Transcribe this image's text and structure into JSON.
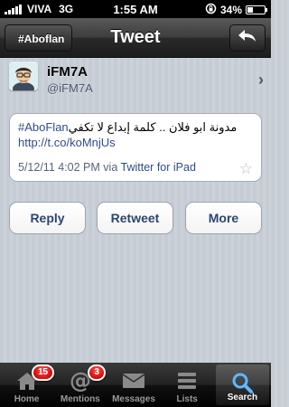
{
  "status_bar": {
    "carrier": "VIVA",
    "network": "3G",
    "time": "1:55 AM",
    "battery": "34%",
    "battery_level": 0.34
  },
  "nav": {
    "back_label": "#Aboflan",
    "title": "Tweet",
    "share_icon": "reply-arrow-icon"
  },
  "profile": {
    "name": "iFM7A",
    "handle": "@iFM7A"
  },
  "tweet": {
    "hashtag": "#AboFlan",
    "text": "مدونة ابو فلان .. كلمة إبداع لا تكفي",
    "link": "http://t.co/koMnjUs",
    "timestamp": "5/12/11 4:02 PM",
    "via": "via",
    "source": "Twitter for iPad"
  },
  "actions": {
    "reply": "Reply",
    "retweet": "Retweet",
    "more": "More"
  },
  "tabs": [
    {
      "label": "Home",
      "icon": "home-icon",
      "badge": "15"
    },
    {
      "label": "Mentions",
      "icon": "at-icon",
      "badge": "3"
    },
    {
      "label": "Messages",
      "icon": "envelope-icon",
      "badge": ""
    },
    {
      "label": "Lists",
      "icon": "list-icon",
      "badge": ""
    },
    {
      "label": "Search",
      "icon": "search-icon",
      "badge": ""
    }
  ],
  "colors": {
    "link": "#2f4d8a",
    "badge": "#d40000",
    "background": "#c5ccd4"
  }
}
